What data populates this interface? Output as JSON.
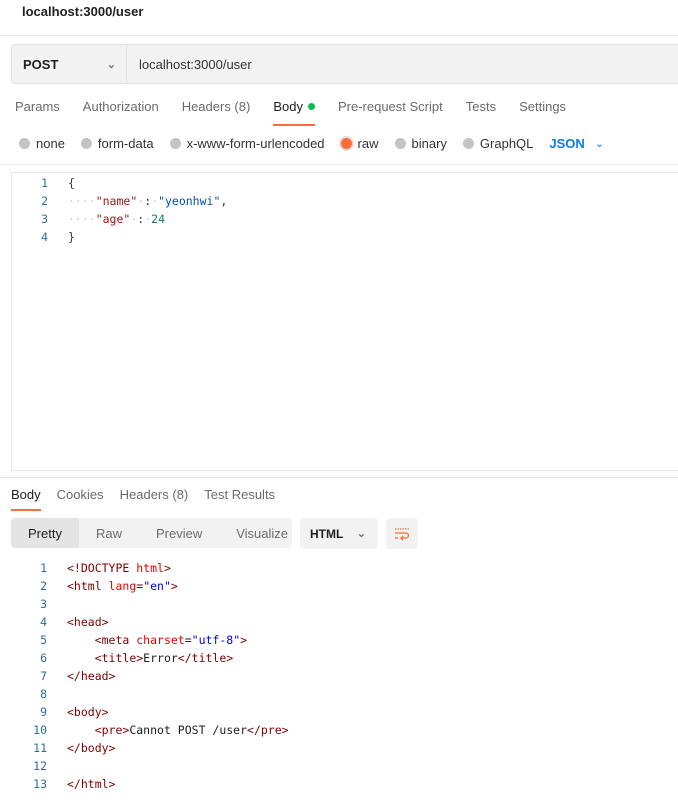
{
  "window": {
    "title": "localhost:3000/user"
  },
  "request": {
    "method": "POST",
    "url": "localhost:3000/user"
  },
  "tabs": [
    {
      "label": "Params"
    },
    {
      "label": "Authorization"
    },
    {
      "label": "Headers (8)"
    },
    {
      "label": "Body",
      "active": true
    },
    {
      "label": "Pre-request Script"
    },
    {
      "label": "Tests"
    },
    {
      "label": "Settings"
    }
  ],
  "body_types": [
    {
      "label": "none"
    },
    {
      "label": "form-data"
    },
    {
      "label": "x-www-form-urlencoded"
    },
    {
      "label": "raw",
      "selected": true
    },
    {
      "label": "binary"
    },
    {
      "label": "GraphQL"
    }
  ],
  "body_format": "JSON",
  "colors": {
    "accent": "#ff6c37",
    "body_dot": "#0cbb52",
    "json_link": "#097bed"
  },
  "request_body": [
    [
      [
        "p",
        "{"
      ]
    ],
    [
      [
        "ws",
        "····"
      ],
      [
        "k",
        "\"name\""
      ],
      [
        "ws",
        "·"
      ],
      [
        "p",
        ":"
      ],
      [
        "ws",
        "·"
      ],
      [
        "s",
        "\"yeonhwi\""
      ],
      [
        "p",
        ","
      ]
    ],
    [
      [
        "ws",
        "····"
      ],
      [
        "k",
        "\"age\""
      ],
      [
        "ws",
        "·"
      ],
      [
        "p",
        ":"
      ],
      [
        "ws",
        "·"
      ],
      [
        "n",
        "24"
      ]
    ],
    [
      [
        "p",
        "}"
      ]
    ]
  ],
  "response_tabs": [
    {
      "label": "Body",
      "active": true
    },
    {
      "label": "Cookies"
    },
    {
      "label": "Headers (8)"
    },
    {
      "label": "Test Results"
    }
  ],
  "view_modes": [
    {
      "label": "Pretty",
      "active": true
    },
    {
      "label": "Raw"
    },
    {
      "label": "Preview"
    },
    {
      "label": "Visualize"
    }
  ],
  "response_format": "HTML",
  "response_body": [
    [
      [
        "t",
        "<!DOCTYPE "
      ],
      [
        "a",
        "html"
      ],
      [
        "t",
        ">"
      ]
    ],
    [
      [
        "t",
        "<html "
      ],
      [
        "a",
        "lang"
      ],
      [
        "x",
        "="
      ],
      [
        "v",
        "\"en\""
      ],
      [
        "t",
        ">"
      ]
    ],
    [],
    [
      [
        "t",
        "<head>"
      ]
    ],
    [
      [
        "x",
        "    "
      ],
      [
        "t",
        "<meta "
      ],
      [
        "a",
        "charset"
      ],
      [
        "x",
        "="
      ],
      [
        "v",
        "\"utf-8\""
      ],
      [
        "t",
        ">"
      ]
    ],
    [
      [
        "x",
        "    "
      ],
      [
        "t",
        "<title>"
      ],
      [
        "x",
        "Error"
      ],
      [
        "t",
        "</title>"
      ]
    ],
    [
      [
        "t",
        "</head>"
      ]
    ],
    [],
    [
      [
        "t",
        "<body>"
      ]
    ],
    [
      [
        "x",
        "    "
      ],
      [
        "t",
        "<pre>"
      ],
      [
        "x",
        "Cannot POST /user"
      ],
      [
        "t",
        "</pre>"
      ]
    ],
    [
      [
        "t",
        "</body>"
      ]
    ],
    [],
    [
      [
        "t",
        "</html>"
      ]
    ]
  ]
}
